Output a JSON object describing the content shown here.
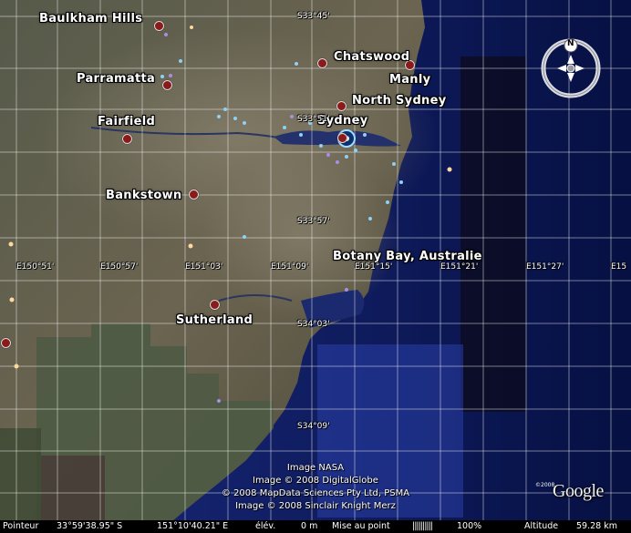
{
  "places": [
    {
      "name": "Baulkham Hills"
    },
    {
      "name": "Parramatta"
    },
    {
      "name": "Fairfield"
    },
    {
      "name": "Bankstown"
    },
    {
      "name": "Sutherland"
    },
    {
      "name": "Chatswood"
    },
    {
      "name": "Manly"
    },
    {
      "name": "North Sydney"
    },
    {
      "name": "Sydney"
    },
    {
      "name": "Botany Bay, Australie"
    }
  ],
  "latitude_labels": [
    "S33°45'",
    "S33°51'",
    "S33°57'",
    "S34°03'",
    "S34°09'"
  ],
  "longitude_labels": [
    "E150°51'",
    "E150°57'",
    "E151°03'",
    "E151°09'",
    "E151°15'",
    "E151°21'",
    "E151°27'",
    "E15"
  ],
  "credits": [
    "Image NASA",
    "Image © 2008 DigitalGlobe",
    "© 2008 MapData Sciences Pty Ltd, PSMA",
    "Image © 2008 Sinclair Knight Merz"
  ],
  "compass": {
    "north_label": "N"
  },
  "logo": {
    "text": "Google",
    "copyright": "©2008"
  },
  "statusbar": {
    "pointer_label": "Pointeur",
    "pointer_lat": "33°59'38.95\" S",
    "pointer_lon": "151°10'40.21\" E",
    "elevation_label": "élév.",
    "elevation_value": "0 m",
    "streaming_label": "Mise au point",
    "streaming_bar": "||||||||||",
    "streaming_percent": "100%",
    "altitude_label": "Altitude",
    "altitude_value": "59.28 km"
  },
  "colors": {
    "land": "#5d5a47",
    "ocean": "#0a1a5c",
    "place_dot": "#8b1a1a",
    "poi_blue": "#8fd0f5",
    "poi_purple": "#a98fe0"
  }
}
